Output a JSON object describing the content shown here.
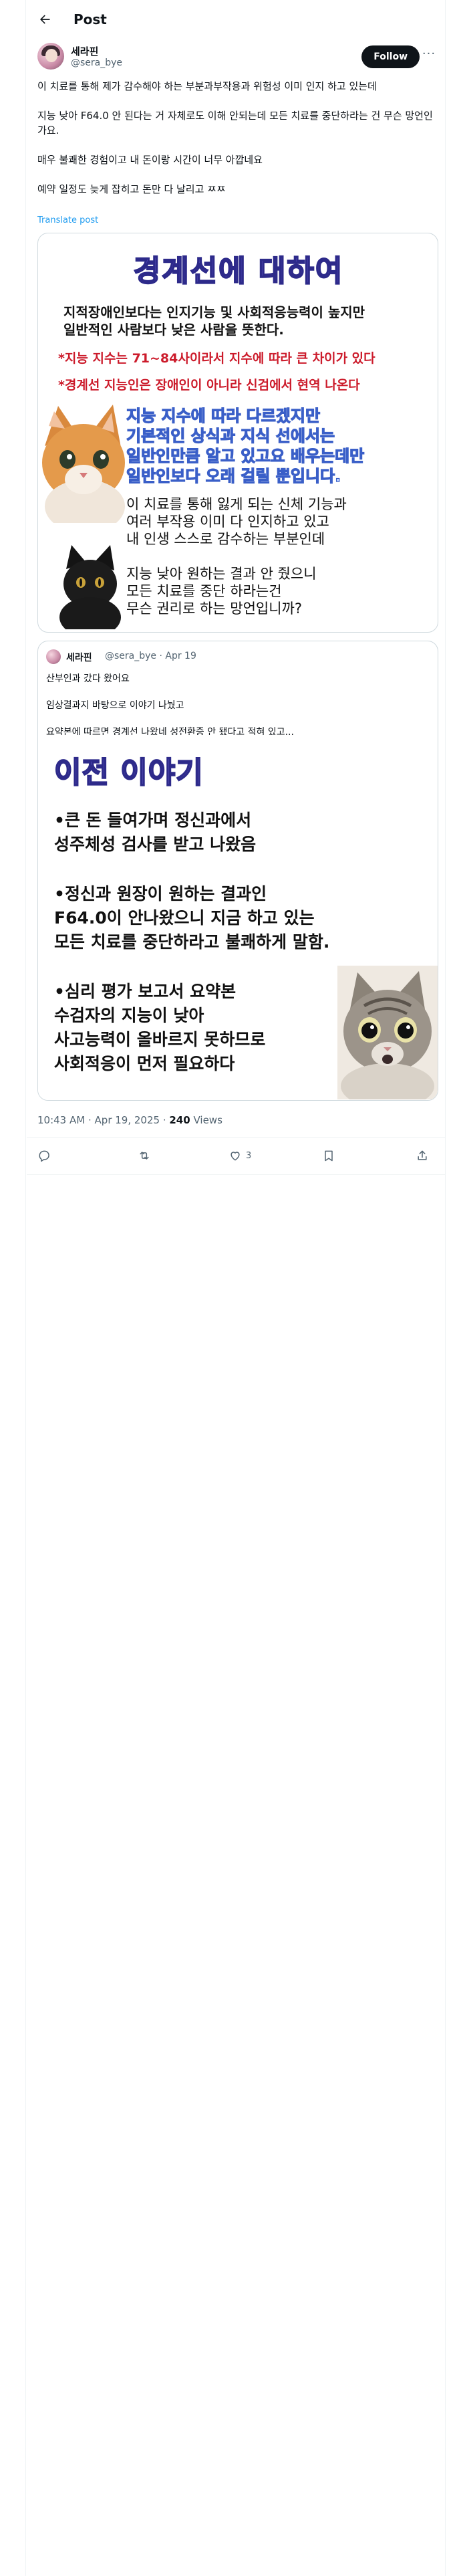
{
  "header": {
    "title": "Post"
  },
  "author": {
    "name": "세라핀",
    "handle": "@sera_bye",
    "follow_label": "Follow"
  },
  "tweet": {
    "paragraphs": [
      "이 치료를 통해 제가 감수해야 하는 부분과부작용과 위험성 이미 인지 하고 있는데",
      "지능 낮아 F64.0 안 된다는 거 자체로도 이해 안되는데 모든 치료를 중단하라는 건 무슨 망언인가요.",
      "매우 불쾌한 경험이고 내 돈이랑 시간이 너무 아깝네요",
      "예약 일정도 늦게 잡히고 돈만 다 날리고 ㅉㅉ"
    ],
    "translate_label": "Translate post"
  },
  "media1": {
    "title": "경계선에 대하여",
    "lines": [
      "지적장애인보다는 인지기능 및 사회적응능력이 높지만",
      "일반적인 사람보다 낮은 사람을 뜻한다.",
      "*지능 지수는 71~84사이라서 지수에 따라 큰 차이가 있다",
      "*경계선 지능인은 장애인이 아니라 신검에서 현역 나온다"
    ],
    "outline_lines": [
      "지능 지수에 따라 다르겠지만",
      "기본적인 상식과 지식 선에서는",
      "일반인만큼 알고 있고요 배우는데만",
      "일반인보다 오래 걸릴 뿐입니다."
    ],
    "plain_lines": [
      "이 치료를 통해 잃게 되는 신체 기능과",
      "여러 부작용 이미 다 인지하고 있고",
      "내 인생 스스로 감수하는 부분인데",
      "지능 낮아 원하는 결과 안 줬으니",
      "모든 치료를 중단 하라는건",
      "무슨 권리로 하는 망언입니까?"
    ]
  },
  "quote": {
    "name": "세라핀",
    "handle": "@sera_bye",
    "date": "Apr 19",
    "paragraphs": [
      "산부인과 갔다 왔어요",
      "임상결과지 바탕으로 이야기 나눴고",
      "요약본에 따르면 경계선 나왔네 성전환증 안 됐다고 적혀 있고..."
    ],
    "image": {
      "title": "이전 이야기",
      "bullets": [
        [
          "•큰 돈 들여가며 정신과에서",
          "성주체성 검사를 받고 나왔음"
        ],
        [
          "•정신과 원장이 원하는 결과인",
          "F64.0이 안나왔으니 지금 하고 있는",
          "모든 치료를 중단하라고 불쾌하게 말함."
        ],
        [
          "•심리 평가 보고서 요약본",
          "수검자의 지능이 낮아",
          "사고능력이 올바르지 못하므로",
          "사회적응이 먼저 필요하다"
        ]
      ]
    }
  },
  "meta": {
    "time": "10:43 AM",
    "date": "Apr 19, 2025",
    "views": "240",
    "views_label": "Views"
  },
  "actions": {
    "likes": "3"
  },
  "icons": [
    "back-arrow-icon",
    "more-icon",
    "reply-icon",
    "repost-icon",
    "like-icon",
    "bookmark-icon",
    "share-icon"
  ]
}
